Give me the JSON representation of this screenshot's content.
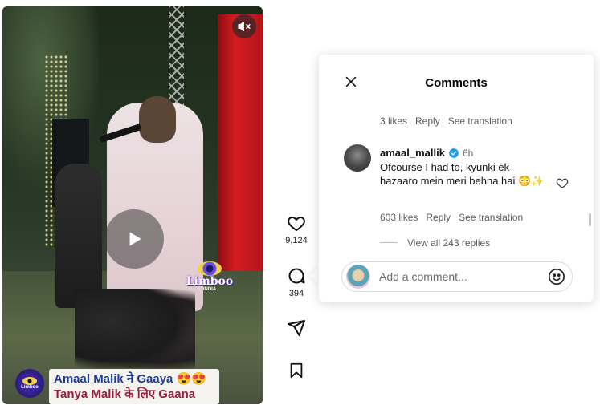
{
  "video": {
    "overlay_logo": {
      "brand": "Limboo",
      "sub": "INDIA"
    },
    "caption": {
      "line1": "Amaal Malik ने Gaaya 😍😍",
      "line2": "Tanya Malik के लिए Gaana"
    },
    "icons": {
      "play": "play-icon",
      "mute": "muted-speaker-icon"
    }
  },
  "actions": {
    "like_count": "9,124",
    "comment_count": "394",
    "icons": [
      "heart-icon",
      "comment-bubble-icon",
      "share-send-icon",
      "bookmark-icon"
    ]
  },
  "comments": {
    "title": "Comments",
    "prev_meta": {
      "likes": "3 likes",
      "reply": "Reply",
      "translate": "See translation"
    },
    "item": {
      "username": "amaal_mallik",
      "time": "6h",
      "verified": true,
      "text": "Ofcourse I had to, kyunki ek hazaaro mein meri behna hai 😳✨",
      "likes": "603 likes",
      "reply": "Reply",
      "translate": "See translation",
      "view_replies": "View all 243 replies"
    },
    "input": {
      "placeholder": "Add a comment..."
    }
  },
  "colors": {
    "verified": "#1d9bf0",
    "caption_line1": "#1f3c93",
    "caption_line2": "#9b1c3c"
  }
}
